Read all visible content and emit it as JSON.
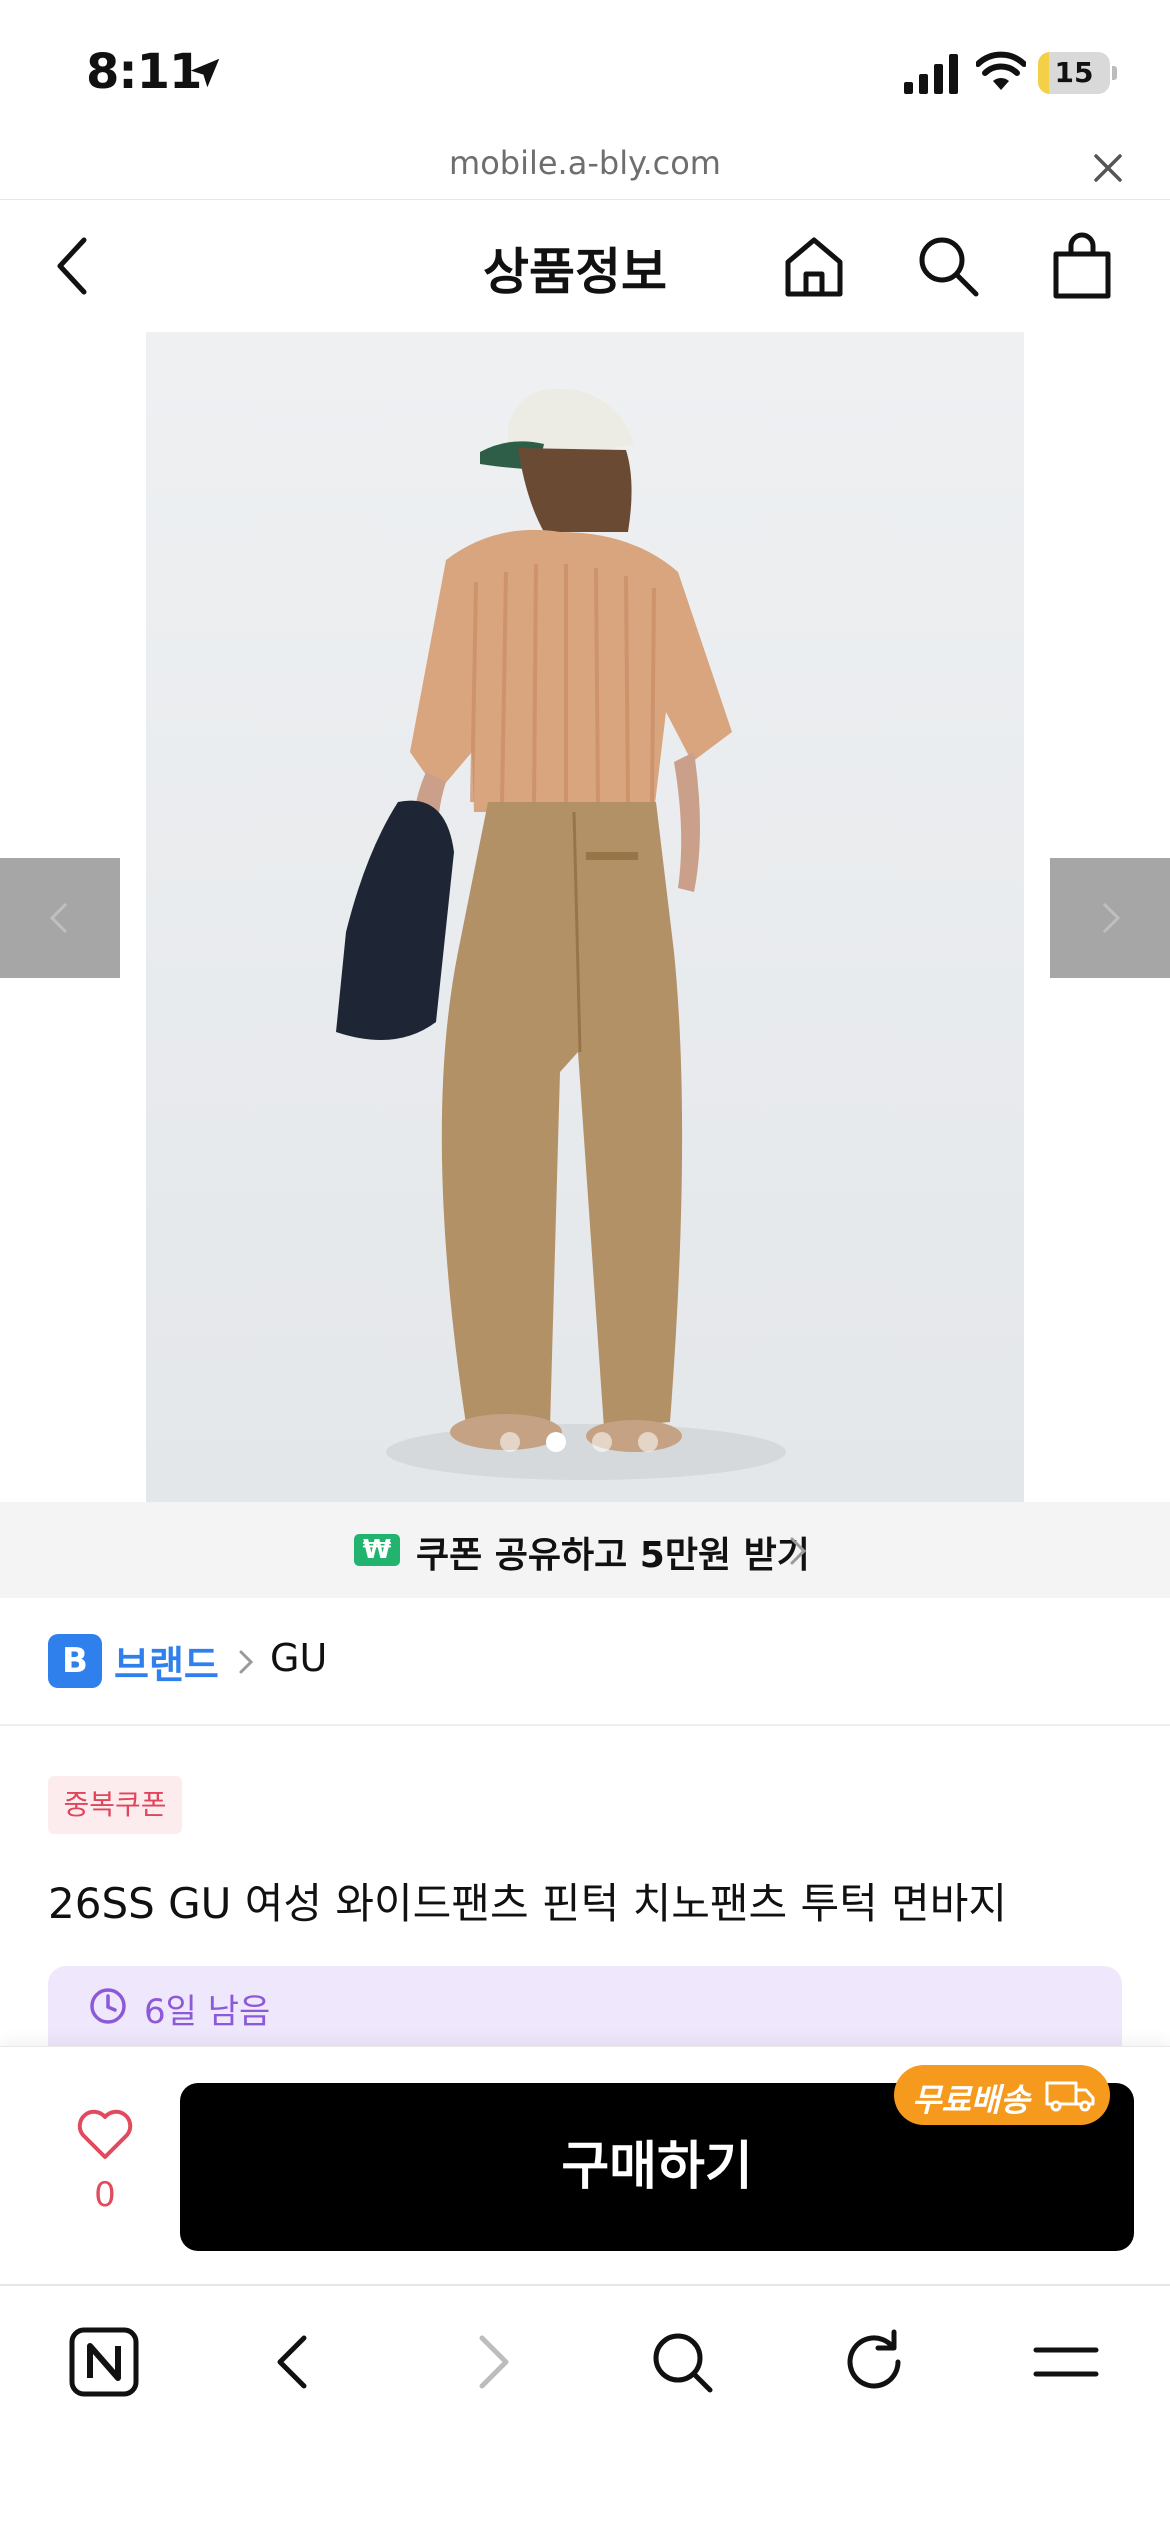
{
  "status_bar": {
    "time": "8:11",
    "battery": "15",
    "battery_level": 0.15
  },
  "url_bar": {
    "url": "mobile.a-bly.com"
  },
  "header": {
    "title": "상품정보"
  },
  "gallery": {
    "image_count": 4,
    "active_index": 1
  },
  "coupon_banner": {
    "icon_text": "₩",
    "text": "쿠폰 공유하고 5만원 받기"
  },
  "brand": {
    "badge": "B",
    "label": "브랜드",
    "name": "GU"
  },
  "product": {
    "badge": "중복쿠폰",
    "title": "26SS GU 여성 와이드팬츠 핀턱 치노팬츠 투턱 면바지",
    "countdown": "6일 남음"
  },
  "buy_bar": {
    "like_count": "0",
    "buy_label": "구매하기",
    "free_shipping_label": "무료배송"
  },
  "colors": {
    "accent_blue": "#2f80ed",
    "coupon_green": "#22b46e",
    "shipping_orange": "#f59a1c",
    "like_red": "#e24a5e",
    "countdown_purple": "#8c5ad8"
  }
}
